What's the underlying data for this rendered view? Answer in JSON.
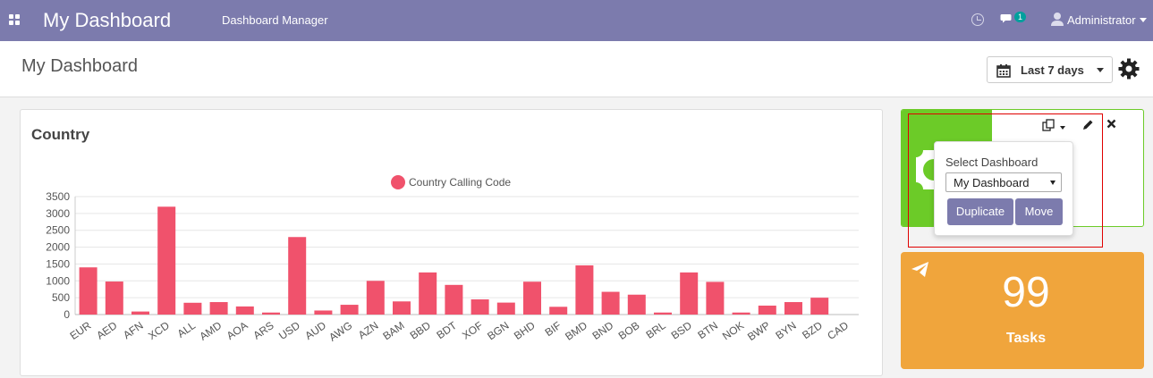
{
  "navbar": {
    "brand": "My Dashboard",
    "menu_item": "Dashboard Manager",
    "chat_badge": "1",
    "user_name": "Administrator"
  },
  "control": {
    "page_title": "My Dashboard",
    "date_filter_label": "Last 7 days"
  },
  "chart_card": {
    "title": "Country"
  },
  "chart_data": {
    "type": "bar",
    "legend_position": "top",
    "series": [
      {
        "name": "Country Calling Code",
        "color": "#f0526c",
        "values": [
          1400,
          980,
          90,
          3200,
          350,
          370,
          240,
          60,
          2300,
          120,
          290,
          1000,
          390,
          1250,
          880,
          450,
          355,
          975,
          230,
          1460,
          675,
          590,
          60,
          1250,
          970,
          60,
          265,
          370,
          500,
          0
        ]
      }
    ],
    "categories": [
      "EUR",
      "AED",
      "AFN",
      "XCD",
      "ALL",
      "AMD",
      "AOA",
      "ARS",
      "USD",
      "AUD",
      "AWG",
      "AZN",
      "BAM",
      "BBD",
      "BDT",
      "XOF",
      "BGN",
      "BHD",
      "BIF",
      "BMD",
      "BND",
      "BOB",
      "BRL",
      "BSD",
      "BTN",
      "NOK",
      "BWP",
      "BYN",
      "BZD",
      "CAD"
    ],
    "yticks": [
      "0",
      "500",
      "1000",
      "1500",
      "2000",
      "2500",
      "3000",
      "3500"
    ],
    "ylim": [
      0,
      3500
    ],
    "grid": true
  },
  "green_tile": {
    "color": "#6ccb28"
  },
  "popover": {
    "label": "Select Dashboard",
    "selected_dashboard": "My Dashboard",
    "duplicate_label": "Duplicate",
    "move_label": "Move"
  },
  "orange_tile": {
    "color": "#f0a53c",
    "value": "99",
    "name": "Tasks"
  }
}
